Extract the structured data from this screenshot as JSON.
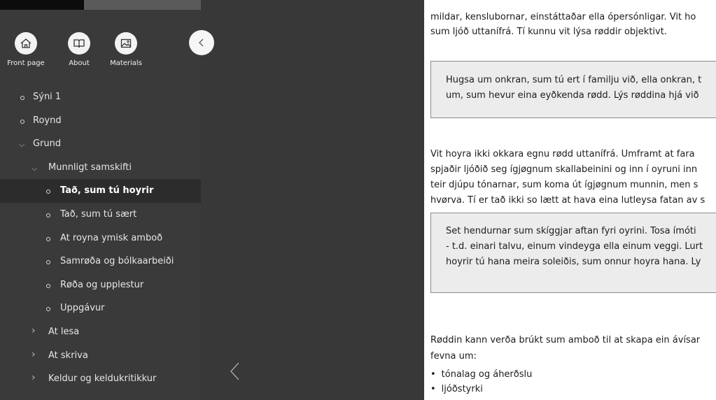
{
  "nav": {
    "front_page": "Front page",
    "about": "About",
    "materials": "Materials"
  },
  "toc": [
    {
      "label": "Sýni 1",
      "type": "bullet",
      "level": 0,
      "active": false
    },
    {
      "label": "Roynd",
      "type": "bullet",
      "level": 0,
      "active": false
    },
    {
      "label": "Grund",
      "type": "expanded",
      "level": 0,
      "active": false
    },
    {
      "label": "Munnligt samskifti",
      "type": "expanded",
      "level": 1,
      "active": false
    },
    {
      "label": "Tað, sum tú hoyrir",
      "type": "bullet",
      "level": 2,
      "active": true
    },
    {
      "label": "Tað, sum tú sært",
      "type": "bullet",
      "level": 2,
      "active": false
    },
    {
      "label": "At royna ymisk amboð",
      "type": "bullet",
      "level": 2,
      "active": false
    },
    {
      "label": "Samrøða og bólkaarbeiði",
      "type": "bullet",
      "level": 2,
      "active": false
    },
    {
      "label": "Røða og upplestur",
      "type": "bullet",
      "level": 2,
      "active": false
    },
    {
      "label": "Uppgávur",
      "type": "bullet",
      "level": 2,
      "active": false
    },
    {
      "label": "At lesa",
      "type": "collapsed",
      "level": 1,
      "active": false
    },
    {
      "label": "At skriva",
      "type": "collapsed",
      "level": 1,
      "active": false
    },
    {
      "label": "Keldur og keldukritikkur",
      "type": "collapsed",
      "level": 1,
      "active": false
    }
  ],
  "content": {
    "p1_line1": "mildar, kenslubornar, einstáttaðar ella ópersónligar. Vit ho",
    "p1_line2": "sum ljóð uttanífrá. Tí kunnu vit lýsa røddir objektivt.",
    "task1_line1": "Hugsa um onkran, sum tú ert í familju við, ella onkran, t",
    "task1_line2": "um, sum hevur eina eyðkenda rødd. Lýs røddina hjá við",
    "p2_line1": "Vit hoyra ikki okkara egnu rødd uttanífrá. Umframt at fara",
    "p2_line2": "spjaðir ljóðið seg ígjøgnum skallabeinini og inn í oyruni inn",
    "p2_line3": "teir djúpu tónarnar, sum koma út ígjøgnum munnin, men s",
    "p2_line4": "hvørva. Tí er tað ikki so lætt at hava eina lutleysa fatan av s",
    "task2_line1": "Set hendurnar sum skíggjar aftan fyri oyrini. Tosa ímóti",
    "task2_line2": "- t.d. einari talvu, einum vindeyga ella einum veggi. Lurt",
    "task2_line3": "hoyrir tú hana meira soleiðis, sum onnur hoyra hana. Ly",
    "p3_line1": "Røddin kann verða brúkt sum amboð til at skapa ein ávísar",
    "p3_line2": "fevna um:",
    "list": [
      "tónalag og áherðslu",
      "ljóðstyrki"
    ]
  }
}
